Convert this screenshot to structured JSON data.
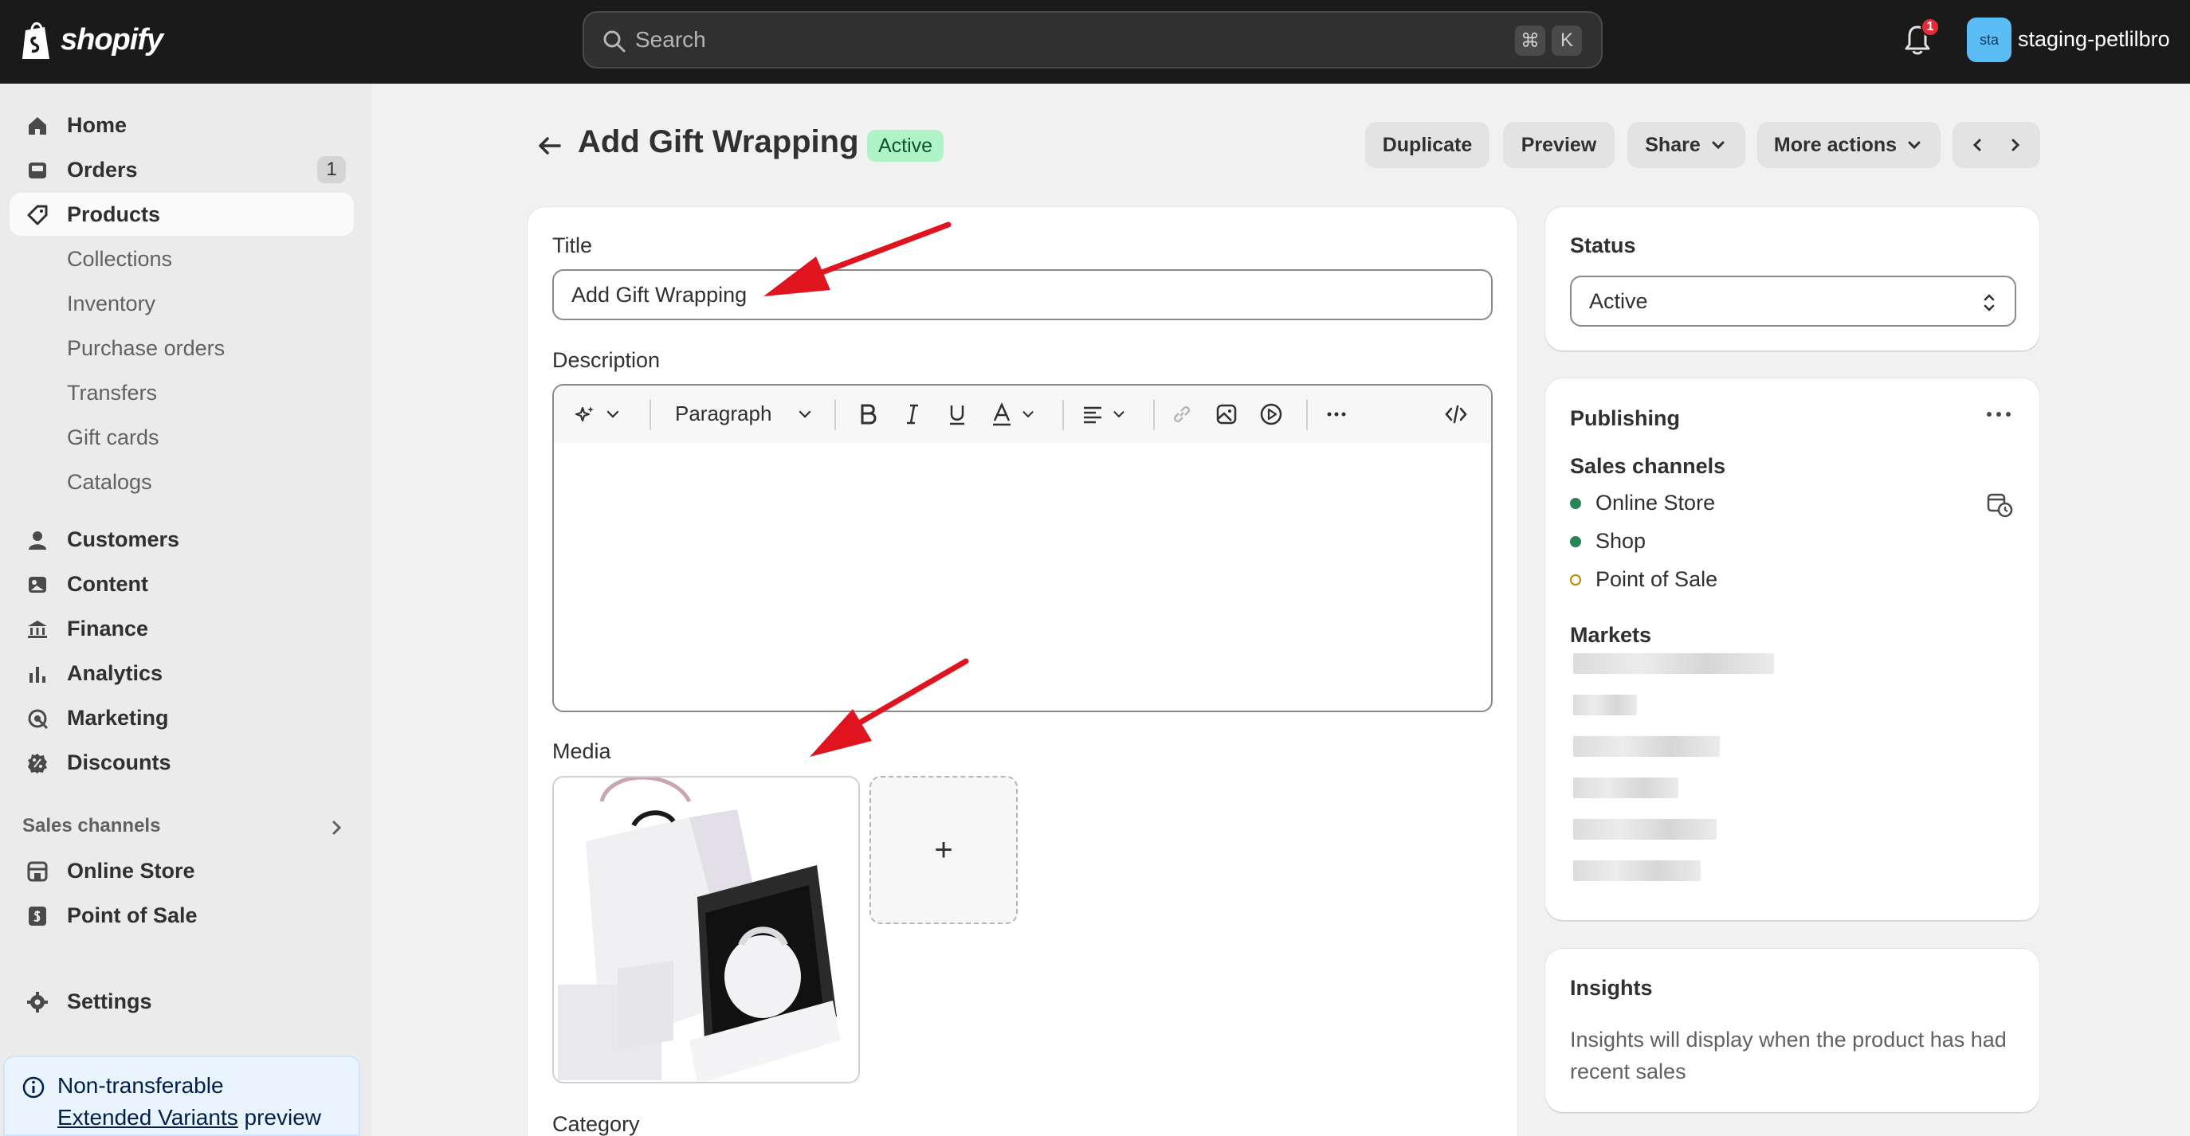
{
  "topbar": {
    "brand": "shopify",
    "search_placeholder": "Search",
    "shortcut_keys": [
      "⌘",
      "K"
    ],
    "notification_count": "1",
    "avatar_initials": "sta",
    "store_name": "staging-petlilbro"
  },
  "sidebar": {
    "items": [
      {
        "label": "Home",
        "icon": "home-icon"
      },
      {
        "label": "Orders",
        "icon": "inbox-icon",
        "badge": "1"
      },
      {
        "label": "Products",
        "icon": "tag-icon",
        "active": true
      },
      {
        "label": "Customers",
        "icon": "person-icon"
      },
      {
        "label": "Content",
        "icon": "content-icon"
      },
      {
        "label": "Finance",
        "icon": "bank-icon"
      },
      {
        "label": "Analytics",
        "icon": "bar-chart-icon"
      },
      {
        "label": "Marketing",
        "icon": "target-icon"
      },
      {
        "label": "Discounts",
        "icon": "discount-icon"
      }
    ],
    "product_subitems": [
      "Collections",
      "Inventory",
      "Purchase orders",
      "Transfers",
      "Gift cards",
      "Catalogs"
    ],
    "sales_channels_label": "Sales channels",
    "channels": [
      {
        "label": "Online Store",
        "icon": "store-icon"
      },
      {
        "label": "Point of Sale",
        "icon": "pos-icon"
      }
    ],
    "settings_label": "Settings",
    "notice": {
      "line1": "Non-transferable",
      "link": "Extended Variants",
      "suffix": " preview"
    }
  },
  "header": {
    "title": "Add Gift Wrapping",
    "status": "Active",
    "buttons": {
      "duplicate": "Duplicate",
      "preview": "Preview",
      "share": "Share",
      "more_actions": "More actions"
    }
  },
  "main": {
    "title_label": "Title",
    "title_value": "Add Gift Wrapping",
    "description_label": "Description",
    "paragraph_style": "Paragraph",
    "media_label": "Media",
    "media_add": "+",
    "category_label": "Category"
  },
  "status_card": {
    "title": "Status",
    "value": "Active"
  },
  "publishing_card": {
    "title": "Publishing",
    "sales_channels_label": "Sales channels",
    "channels": [
      {
        "label": "Online Store",
        "state": "published"
      },
      {
        "label": "Shop",
        "state": "published"
      },
      {
        "label": "Point of Sale",
        "state": "unpublished"
      }
    ],
    "markets_label": "Markets"
  },
  "insights_card": {
    "title": "Insights",
    "text": "Insights will display when the product has had recent sales"
  },
  "colors": {
    "topbar": "#1a1a1a",
    "active_badge_bg": "#aff4c6",
    "active_badge_text": "#0c5132",
    "annotation_arrow": "#e0141e",
    "published_dot": "#29845a"
  }
}
